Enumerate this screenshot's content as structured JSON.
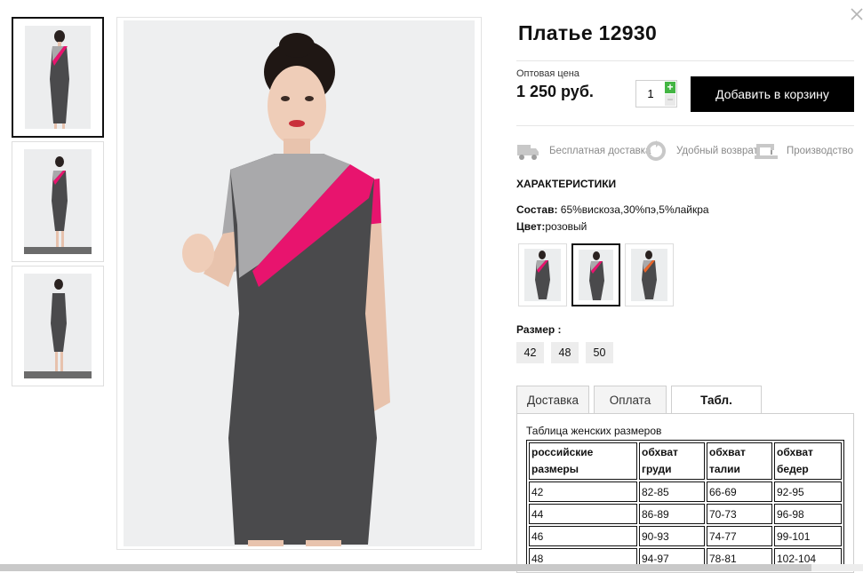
{
  "product": {
    "title": "Платье 12930",
    "price_label": "Оптовая цена",
    "price": "1 250 руб.",
    "quantity": "1",
    "add_to_cart_label": "Добавить в корзину"
  },
  "features": [
    {
      "icon": "truck-icon",
      "label": "Бесплатная доставка"
    },
    {
      "icon": "return-icon",
      "label": "Удобный возврат"
    },
    {
      "icon": "sewing-machine-icon",
      "label": "Производство"
    }
  ],
  "characteristics": {
    "title": "ХАРАКТЕРИСТИКИ",
    "composition_label": "Состав:",
    "composition_value": "65%вискоза,30%пэ,5%лайкра",
    "color_label": "Цвет:",
    "color_value": "розовый"
  },
  "color_swatches": [
    {
      "accent": "#e8146e",
      "selected": false
    },
    {
      "accent": "#e8146e",
      "selected": true
    },
    {
      "accent": "#e8642a",
      "selected": false
    }
  ],
  "size": {
    "label": "Размер :",
    "options": [
      "42",
      "48",
      "50"
    ]
  },
  "tabs": [
    {
      "label": "Доставка",
      "active": false
    },
    {
      "label": "Оплата",
      "active": false
    },
    {
      "label": "Табл. размеров",
      "active": true
    }
  ],
  "size_table": {
    "title": "Таблица женских размеров",
    "headers": [
      "российские размеры",
      "обхват груди",
      "обхват талии",
      "обхват бедер"
    ],
    "rows": [
      [
        "42",
        "82-85",
        "66-69",
        "92-95"
      ],
      [
        "44",
        "86-89",
        "70-73",
        "96-98"
      ],
      [
        "46",
        "90-93",
        "74-77",
        "99-101"
      ],
      [
        "48",
        "94-97",
        "78-81",
        "102-104"
      ]
    ]
  },
  "colors": {
    "accent_pink": "#e8146e",
    "dress_gray": "#4a4a4c",
    "sleeve_gray": "#a9a9ab",
    "plus_green": "#44b544",
    "button_black": "#000000"
  }
}
